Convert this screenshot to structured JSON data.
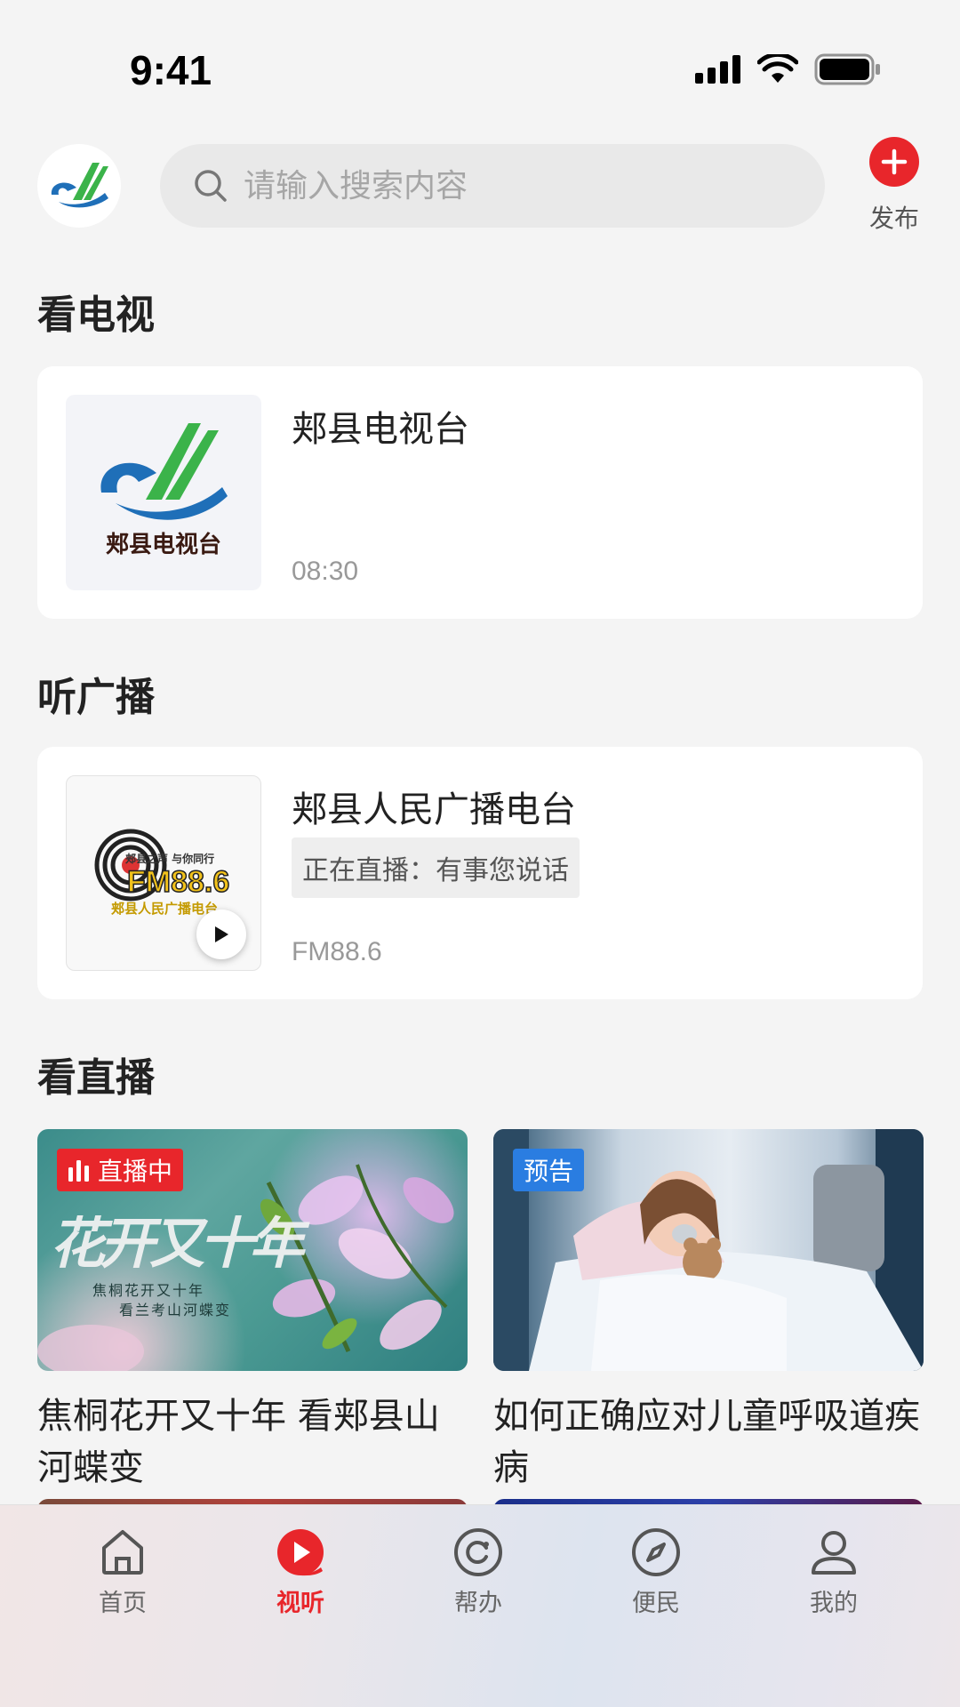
{
  "status_bar": {
    "time": "9:41"
  },
  "header": {
    "search_placeholder": "请输入搜索内容",
    "publish_label": "发布"
  },
  "tv_section": {
    "title": "看电视",
    "card": {
      "name": "郏县电视台",
      "logo_text": "郏县电视台",
      "time": "08:30"
    }
  },
  "radio_section": {
    "title": "听广播",
    "card": {
      "name": "郏县人民广播电台",
      "now_playing": "正在直播：有事您说话",
      "frequency": "FM88.6",
      "logo_top": "郏县之声 与你同行",
      "logo_fm": "FM88.6",
      "logo_bottom": "郏县人民广播电台"
    }
  },
  "live_section": {
    "title": "看直播",
    "items": [
      {
        "badge": "直播中",
        "badge_color": "#e8262b",
        "title": "焦桐花开又十年 看郏县山河蝶变",
        "art_title": "花开又十年",
        "art_line1": "焦桐花开又十年",
        "art_line2": "看兰考山河蝶变"
      },
      {
        "badge": "预告",
        "badge_color": "#2a7de1",
        "title": "如何正确应对儿童呼吸道疾病"
      }
    ]
  },
  "tabbar": {
    "tabs": [
      {
        "label": "首页",
        "icon": "home-icon"
      },
      {
        "label": "视听",
        "icon": "play-icon",
        "active": true
      },
      {
        "label": "帮办",
        "icon": "help-icon"
      },
      {
        "label": "便民",
        "icon": "compass-icon"
      },
      {
        "label": "我的",
        "icon": "user-icon"
      }
    ]
  },
  "colors": {
    "accent": "#e8262b",
    "preview_blue": "#2a7de1"
  }
}
